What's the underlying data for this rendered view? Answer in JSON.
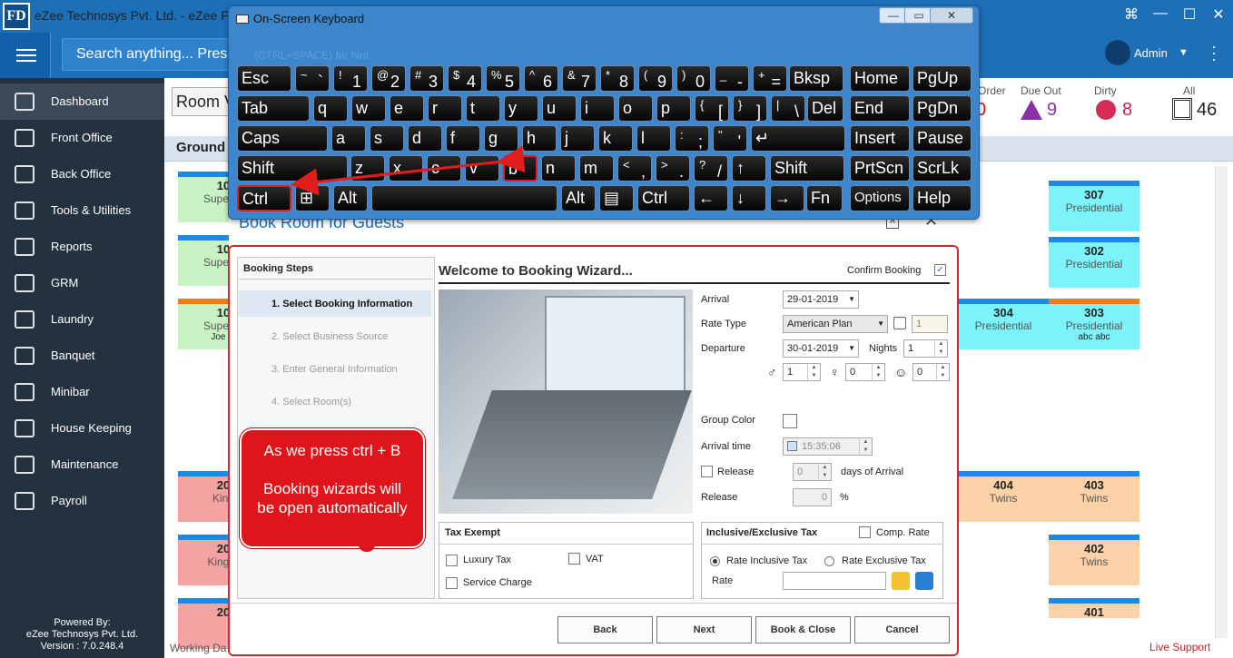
{
  "app": {
    "logo": "FD",
    "title": "eZee Technosys Pvt. Ltd. - eZee F",
    "search_placeholder": "Search anything... Press",
    "user": "Admin"
  },
  "sidebar": {
    "items": [
      {
        "label": "Dashboard",
        "icon": "chart-icon"
      },
      {
        "label": "Front Office",
        "icon": "front-desk-icon"
      },
      {
        "label": "Back Office",
        "icon": "back-office-icon"
      },
      {
        "label": "Tools & Utilities",
        "icon": "tools-icon"
      },
      {
        "label": "Reports",
        "icon": "report-icon"
      },
      {
        "label": "GRM",
        "icon": "grm-icon"
      },
      {
        "label": "Laundry",
        "icon": "iron-icon"
      },
      {
        "label": "Banquet",
        "icon": "banquet-icon"
      },
      {
        "label": "Minibar",
        "icon": "minibar-icon"
      },
      {
        "label": "House Keeping",
        "icon": "housekeeping-icon"
      },
      {
        "label": "Maintenance",
        "icon": "maintenance-icon"
      },
      {
        "label": "Payroll",
        "icon": "payroll-icon"
      }
    ],
    "powered_line1": "Powered By:",
    "powered_line2": "eZee Technosys Pvt. Ltd.",
    "version": "Version : 7.0.248.4"
  },
  "main": {
    "room_view": "Room V",
    "floor": "Ground",
    "working_day": "Working Da",
    "live_support": "Live Support",
    "stats": [
      {
        "caption": "Order",
        "value": "0"
      },
      {
        "caption": "Due Out",
        "value": "9"
      },
      {
        "caption": "Dirty",
        "value": "8"
      },
      {
        "caption": "All",
        "value": "46"
      }
    ],
    "rooms_left": [
      {
        "num": "10",
        "type": "Super D"
      },
      {
        "num": "10",
        "type": "Super D"
      },
      {
        "num": "10",
        "type": "Super D",
        "guest": "Joe M"
      },
      {
        "num": "20",
        "type": "King"
      },
      {
        "num": "20",
        "type": "King S"
      },
      {
        "num": "20",
        "type": ""
      }
    ],
    "rooms_right": [
      {
        "num": "307",
        "type": "Presidential"
      },
      {
        "num": "302",
        "type": "Presidential"
      },
      {
        "num": "304",
        "type": "Presidential"
      },
      {
        "num": "303",
        "type": "Presidential",
        "guest": "abc abc"
      },
      {
        "num": "404",
        "type": "Twins"
      },
      {
        "num": "403",
        "type": "Twins"
      },
      {
        "num": "402",
        "type": "Twins"
      },
      {
        "num": "401",
        "type": ""
      }
    ]
  },
  "osk": {
    "title": "On-Screen Keyboard",
    "hint": "(CTRL+SPACE) for hint",
    "rows": [
      [
        "Esc",
        "~ `",
        "! 1",
        "@ 2",
        "# 3",
        "$ 4",
        "% 5",
        "^ 6",
        "& 7",
        "* 8",
        "( 9",
        ") 0",
        "_ -",
        "+ =",
        "Bksp",
        "Home",
        "PgUp"
      ],
      [
        "Tab",
        "q",
        "w",
        "e",
        "r",
        "t",
        "y",
        "u",
        "i",
        "o",
        "p",
        "{ [",
        "} ]",
        "| \\",
        "Del",
        "End",
        "PgDn"
      ],
      [
        "Caps",
        "a",
        "s",
        "d",
        "f",
        "g",
        "h",
        "j",
        "k",
        "l",
        ": ;",
        "\" '",
        "↵",
        "Insert",
        "Pause"
      ],
      [
        "Shift",
        "z",
        "x",
        "c",
        "v",
        "b",
        "n",
        "m",
        "< ,",
        "> .",
        "? /",
        "↑",
        "Shift",
        "PrtScn",
        "ScrLk"
      ],
      [
        "Ctrl",
        "⊞",
        "Alt",
        "",
        "Alt",
        "▤",
        "Ctrl",
        "←",
        "↓",
        "→",
        "Fn",
        "Options",
        "Help"
      ]
    ]
  },
  "dialog": {
    "title": "Book Room for Guests",
    "steps_header": "Booking Steps",
    "steps": [
      "1.  Select Booking Information",
      "2.  Select Business Source",
      "3.  Enter General Information",
      "4.  Select Room(s)"
    ],
    "wizard_title": "Welcome to Booking Wizard...",
    "confirm_booking": "Confirm Booking",
    "fields": {
      "arrival_label": "Arrival",
      "arrival_value": "29-01-2019",
      "rate_type_label": "Rate Type",
      "rate_type_value": "American Plan",
      "rate_qty": "1",
      "departure_label": "Departure",
      "departure_value": "30-01-2019",
      "nights_label": "Nights",
      "nights_value": "1",
      "adult": "1",
      "child": "0",
      "infant": "0",
      "group_color_label": "Group Color",
      "arrival_time_label": "Arrival time",
      "arrival_time_value": "15:35:06",
      "release_label": "Release",
      "release_days": "0",
      "days_of_arrival": "days of Arrival",
      "release2_label": "Release",
      "release_pct": "0",
      "pct": "%"
    },
    "tax_exempt": {
      "title": "Tax Exempt",
      "luxury": "Luxury Tax",
      "vat": "VAT",
      "service": "Service Charge"
    },
    "incl_excl": {
      "title": "Inclusive/Exclusive Tax",
      "comp_rate": "Comp. Rate",
      "incl": "Rate Inclusive Tax",
      "excl": "Rate Exclusive Tax",
      "rate": "Rate"
    },
    "buttons": {
      "back": "Back",
      "next": "Next",
      "book_close": "Book & Close",
      "cancel": "Cancel"
    }
  },
  "callout": {
    "line1": "As we press ctrl + B",
    "line2": "Booking wizards will be open automatically"
  },
  "colors": {
    "accent": "#1d6fb8",
    "sidebar": "#24313f",
    "highlight": "#e0242a"
  }
}
